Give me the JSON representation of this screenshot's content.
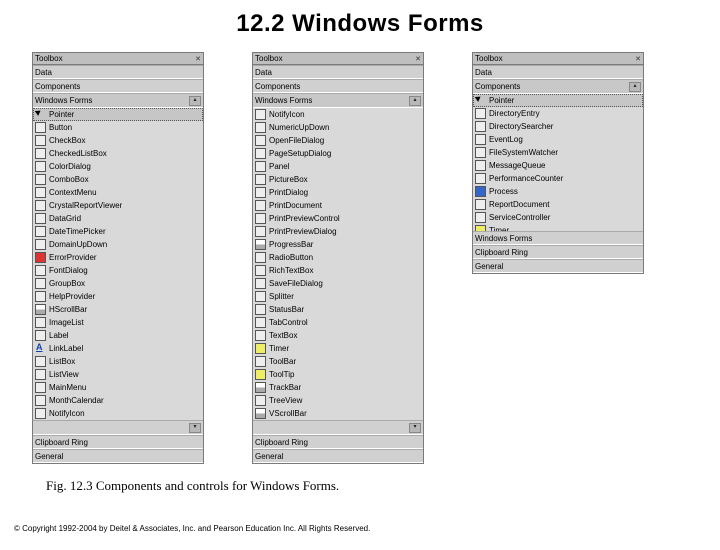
{
  "title": "12.2  Windows Forms",
  "caption": "Fig. 12.3    Components and controls for Windows Forms.",
  "copyright": "© Copyright 1992-2004 by Deitel & Associates, Inc. and Pearson Education Inc. All Rights Reserved.",
  "header_label": "Toolbox",
  "sections": {
    "data": "Data",
    "components": "Components",
    "winforms": "Windows Forms",
    "clipboard": "Clipboard Ring",
    "general": "General"
  },
  "panel1": {
    "pointer": "Pointer",
    "items": [
      "Button",
      "CheckBox",
      "CheckedListBox",
      "ColorDialog",
      "ComboBox",
      "ContextMenu",
      "CrystalReportViewer",
      "DataGrid",
      "DateTimePicker",
      "DomainUpDown",
      "ErrorProvider",
      "FontDialog",
      "GroupBox",
      "HelpProvider",
      "HScrollBar",
      "ImageList",
      "Label",
      "LinkLabel",
      "ListBox",
      "ListView",
      "MainMenu",
      "MonthCalendar",
      "NotifyIcon"
    ]
  },
  "panel2": {
    "items": [
      "NotifyIcon",
      "NumericUpDown",
      "OpenFileDialog",
      "PageSetupDialog",
      "Panel",
      "PictureBox",
      "PrintDialog",
      "PrintDocument",
      "PrintPreviewControl",
      "PrintPreviewDialog",
      "ProgressBar",
      "RadioButton",
      "RichTextBox",
      "SaveFileDialog",
      "Splitter",
      "StatusBar",
      "TabControl",
      "TextBox",
      "Timer",
      "ToolBar",
      "ToolTip",
      "TrackBar",
      "TreeView",
      "VScrollBar"
    ]
  },
  "panel3": {
    "pointer": "Pointer",
    "items": [
      "DirectoryEntry",
      "DirectorySearcher",
      "EventLog",
      "FileSystemWatcher",
      "MessageQueue",
      "PerformanceCounter",
      "Process",
      "ReportDocument",
      "ServiceController",
      "Timer"
    ]
  }
}
